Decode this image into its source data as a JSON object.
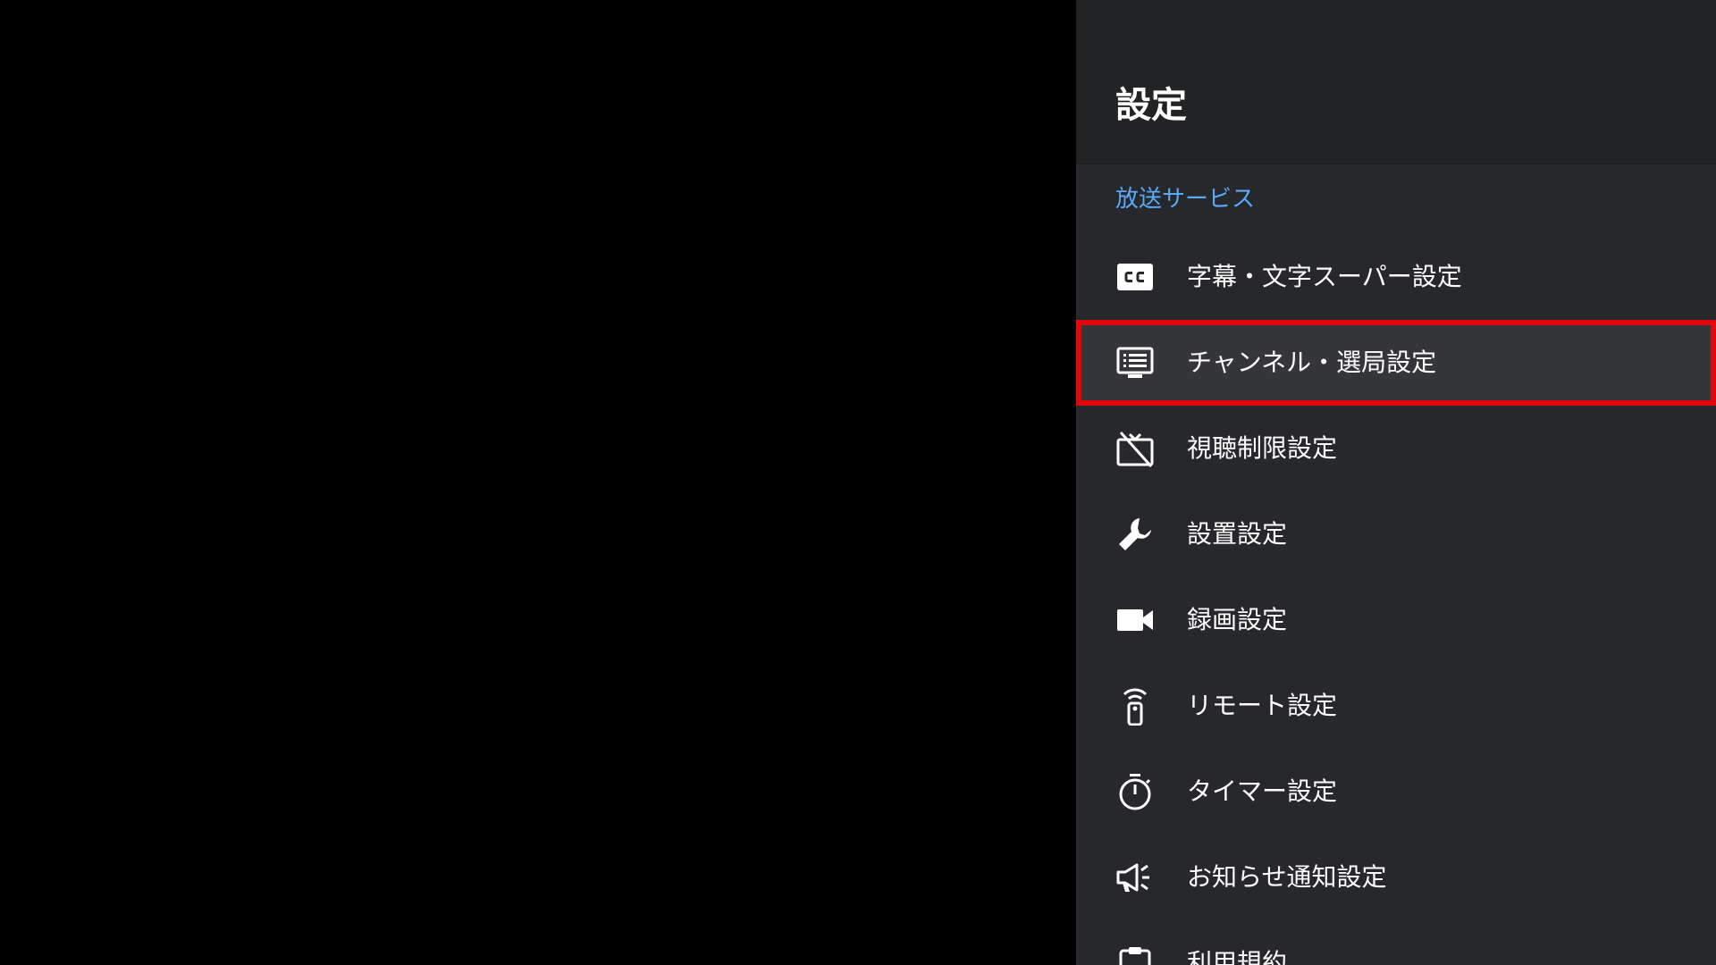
{
  "panel": {
    "title": "設定",
    "section_label": "放送サービス",
    "accent_color": "#5aa9f5",
    "highlight_color": "#e0080b",
    "items": [
      {
        "label": "字幕・文字スーパー設定",
        "icon": "closed-caption-icon",
        "selected": false
      },
      {
        "label": "チャンネル・選局設定",
        "icon": "channel-list-icon",
        "selected": true
      },
      {
        "label": "視聴制限設定",
        "icon": "tv-off-icon",
        "selected": false
      },
      {
        "label": "設置設定",
        "icon": "wrench-icon",
        "selected": false
      },
      {
        "label": "録画設定",
        "icon": "video-camera-icon",
        "selected": false
      },
      {
        "label": "リモート設定",
        "icon": "remote-icon",
        "selected": false
      },
      {
        "label": "タイマー設定",
        "icon": "timer-icon",
        "selected": false
      },
      {
        "label": "お知らせ通知設定",
        "icon": "megaphone-icon",
        "selected": false
      },
      {
        "label": "利用規約",
        "icon": "clipboard-icon",
        "selected": false
      }
    ]
  }
}
